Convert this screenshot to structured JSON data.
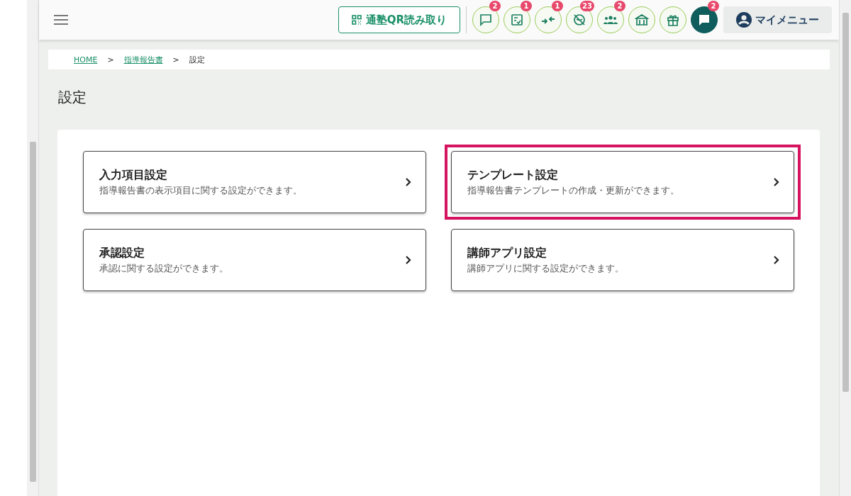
{
  "header": {
    "qr_button": "通塾QR読み取り",
    "icon_buttons": [
      {
        "kind": "chat",
        "badge": "2"
      },
      {
        "kind": "checklist",
        "badge": "1"
      },
      {
        "kind": "merge",
        "badge": "1"
      },
      {
        "kind": "hidden",
        "badge": "23"
      },
      {
        "kind": "group",
        "badge": "2"
      },
      {
        "kind": "store"
      },
      {
        "kind": "gift"
      },
      {
        "kind": "chat-filled",
        "badge": "2"
      }
    ],
    "my_menu": "マイメニュー"
  },
  "breadcrumb": [
    {
      "label": "HOME",
      "link": true
    },
    {
      "label": "指導報告書",
      "link": true
    },
    {
      "label": "設定",
      "link": false
    }
  ],
  "breadcrumb_separator": ">",
  "page_title": "設定",
  "cards": [
    {
      "title": "入力項目設定",
      "description": "指導報告書の表示項目に関する設定ができます。",
      "highlighted": false
    },
    {
      "title": "テンプレート設定",
      "description": "指導報告書テンプレートの作成・更新ができます。",
      "highlighted": true
    },
    {
      "title": "承認設定",
      "description": "承認に関する設定ができます。",
      "highlighted": false
    },
    {
      "title": "講師アプリ設定",
      "description": "講師アプリに関する設定ができます。",
      "highlighted": false
    }
  ]
}
